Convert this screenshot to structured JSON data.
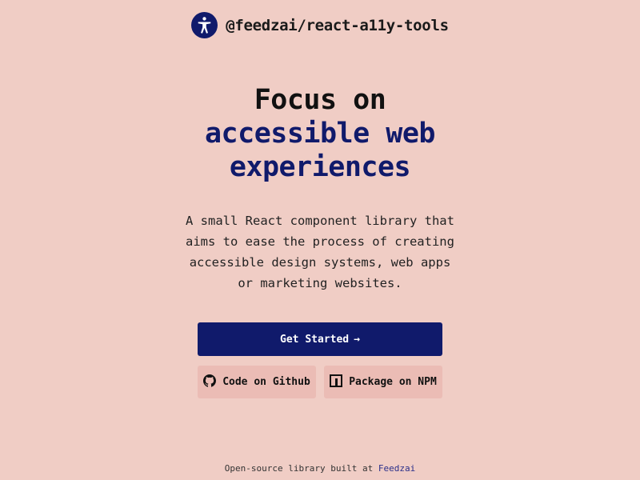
{
  "brand": {
    "name": "@feedzai/react-a11y-tools",
    "logo_icon": "accessibility-icon"
  },
  "hero": {
    "line1": "Focus on",
    "line2": "accessible web",
    "line3": "experiences"
  },
  "description": {
    "lines": [
      "A small React component library that",
      "aims to ease the process of creating",
      "accessible design systems, web apps",
      "or marketing websites."
    ]
  },
  "actions": {
    "primary_label": "Get Started",
    "primary_arrow": "→",
    "github_label": "Code on Github",
    "github_icon": "github-icon",
    "npm_label": "Package on NPM",
    "npm_icon": "npm-icon"
  },
  "footer": {
    "text": "Open-source library built at ",
    "link": "Feedzai"
  },
  "colors": {
    "background": "#f0cdc5",
    "accent": "#101a6b",
    "secondary_button": "#ebbcb5"
  }
}
